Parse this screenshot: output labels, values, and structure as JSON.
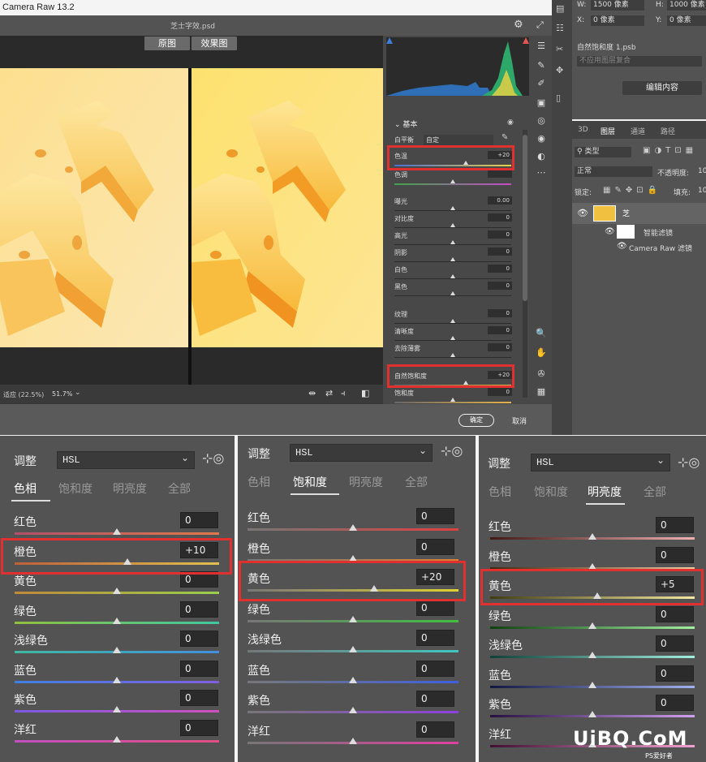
{
  "app_title": "Camera Raw 13.2",
  "file_name": "芝士字效.psd",
  "view_labels": {
    "before": "原图",
    "after": "效果图"
  },
  "zoom": {
    "fit_label": "适应 (22.5%)",
    "value": "51.7%"
  },
  "footer": {
    "ok": "确定",
    "cancel": "取消"
  },
  "basic": {
    "section": "基本",
    "wb_label": "白平衡",
    "wb_value": "自定",
    "rows": [
      {
        "label": "色温",
        "value": "+20"
      },
      {
        "label": "色调",
        "value": ""
      },
      {
        "label": "曝光",
        "value": "0.00"
      },
      {
        "label": "对比度",
        "value": "0"
      },
      {
        "label": "高光",
        "value": "0"
      },
      {
        "label": "阴影",
        "value": "0"
      },
      {
        "label": "白色",
        "value": "0"
      },
      {
        "label": "黑色",
        "value": "0"
      },
      {
        "label": "纹理",
        "value": "0"
      },
      {
        "label": "清晰度",
        "value": "0"
      },
      {
        "label": "去除薄雾",
        "value": "0"
      },
      {
        "label": "自然饱和度",
        "value": "+20"
      },
      {
        "label": "饱和度",
        "value": "0"
      }
    ]
  },
  "ps": {
    "w_label": "W:",
    "w_value": "1500 像素",
    "h_label": "H:",
    "h_value": "1000 像素",
    "x_label": "X:",
    "x_value": "0 像素",
    "y_label": "Y:",
    "y_value": "0 像素",
    "doc_name": "自然饱和度 1.psb",
    "comp_placeholder": "不应用图层复合",
    "edit_btn": "编辑内容",
    "tabs": [
      "3D",
      "图层",
      "通道",
      "路径"
    ],
    "filter_kind": "类型",
    "blend_mode": "正常",
    "opacity_label": "不透明度:",
    "opacity_value": "10",
    "lock_label": "锁定:",
    "fill_label": "填充:",
    "fill_value": "10",
    "layer_name": "芝",
    "smart_filter": "智能滤镜",
    "camera_raw_filter": "Camera Raw 滤镜"
  },
  "hsl": {
    "title": "调整",
    "mode": "HSL",
    "tabs": [
      "色相",
      "饱和度",
      "明亮度",
      "全部"
    ],
    "colors": [
      "红色",
      "橙色",
      "黄色",
      "绿色",
      "浅绿色",
      "蓝色",
      "紫色",
      "洋红"
    ],
    "panels": [
      {
        "active_tab": 0,
        "values": [
          "0",
          "+10",
          "0",
          "0",
          "0",
          "0",
          "0",
          "0"
        ]
      },
      {
        "active_tab": 1,
        "values": [
          "0",
          "0",
          "+20",
          "0",
          "0",
          "0",
          "0",
          "0"
        ]
      },
      {
        "active_tab": 2,
        "values": [
          "0",
          "0",
          "+5",
          "0",
          "0",
          "0",
          "0",
          ""
        ]
      }
    ]
  },
  "watermark": {
    "main": "UiBQ.CoM",
    "sub": "PS爱好者"
  }
}
